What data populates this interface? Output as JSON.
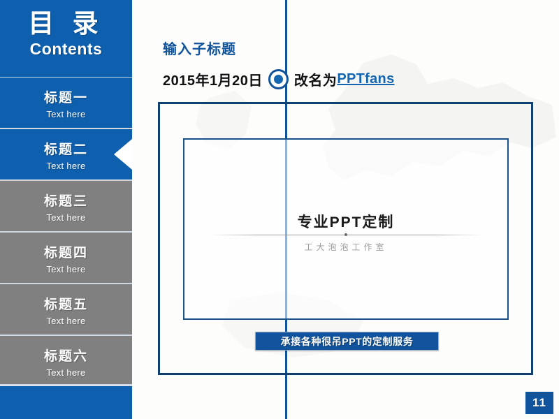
{
  "sidebar": {
    "title_cn": "目 录",
    "title_en": "Contents",
    "items": [
      {
        "label": "标题一",
        "sub": "Text here",
        "state": "blue",
        "active": false
      },
      {
        "label": "标题二",
        "sub": "Text here",
        "state": "blue",
        "active": true
      },
      {
        "label": "标题三",
        "sub": "Text here",
        "state": "gray",
        "active": false
      },
      {
        "label": "标题四",
        "sub": "Text here",
        "state": "gray",
        "active": false
      },
      {
        "label": "标题五",
        "sub": "Text here",
        "state": "gray",
        "active": false
      },
      {
        "label": "标题六",
        "sub": "Text here",
        "state": "gray",
        "active": false
      }
    ]
  },
  "header": {
    "subtitle": "输入子标题",
    "date": "2015年1月20日",
    "rename_prefix": "改名为",
    "brand": "PPTfans"
  },
  "content": {
    "logo_main": "专业PPT定制",
    "logo_sub": "工大泡泡工作室"
  },
  "banner": {
    "text": "承接各种很吊PPT的定制服务"
  },
  "footer": {
    "page_number": "11"
  },
  "colors": {
    "brand_blue": "#0E5FAE",
    "deep_blue": "#10406f",
    "gray_item": "#808080",
    "link_blue": "#1565b0",
    "banner_blue": "#11549d"
  }
}
